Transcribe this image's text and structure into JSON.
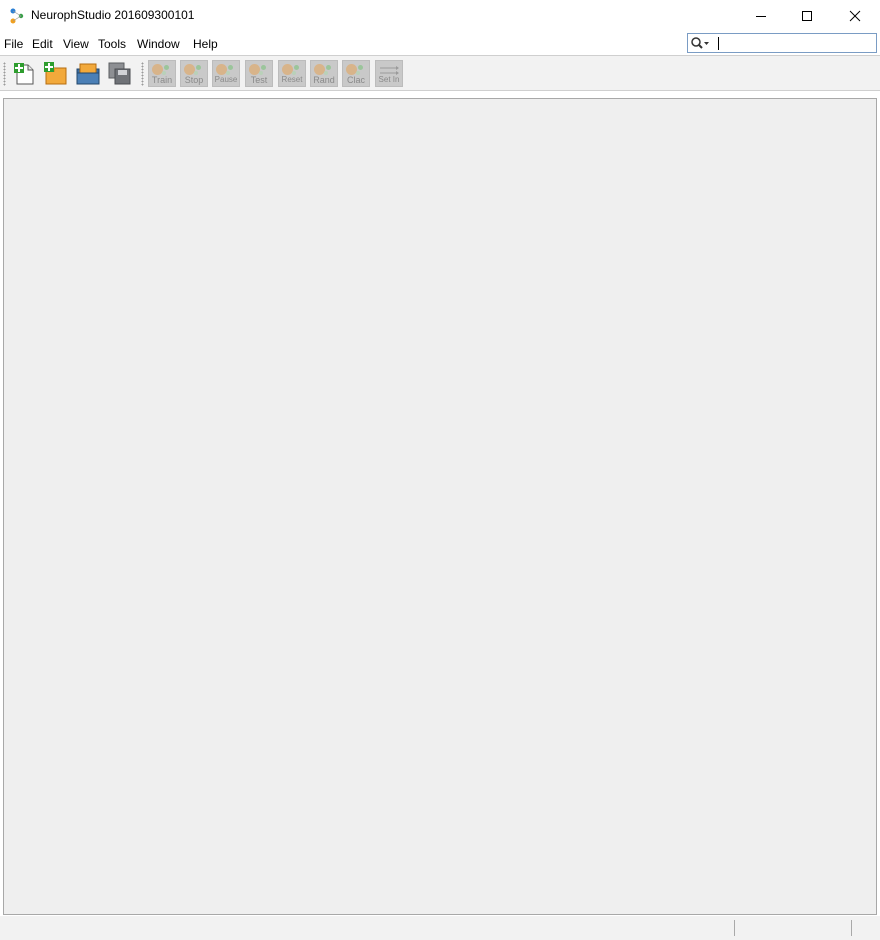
{
  "window": {
    "title": "NeurophStudio 201609300101",
    "controls": [
      "minimize-icon",
      "maximize-icon",
      "close-icon"
    ]
  },
  "menu": {
    "items": [
      {
        "label": "File"
      },
      {
        "label": "Edit"
      },
      {
        "label": "View"
      },
      {
        "label": "Tools"
      },
      {
        "label": "Window"
      },
      {
        "label": "Help"
      }
    ]
  },
  "search": {
    "value": "",
    "icon": "search-icon"
  },
  "toolbar": {
    "file_buttons": [
      {
        "icon": "new-file-icon"
      },
      {
        "icon": "new-project-icon"
      },
      {
        "icon": "open-project-icon"
      },
      {
        "icon": "save-all-icon"
      }
    ],
    "run_buttons": [
      {
        "label": "Train"
      },
      {
        "label": "Stop"
      },
      {
        "label": "Pause"
      },
      {
        "label": "Test"
      },
      {
        "label": "Reset"
      },
      {
        "label": "Rand"
      },
      {
        "label": "Clac"
      },
      {
        "label": "Set In"
      }
    ]
  },
  "colors": {
    "workspace": "#efefef",
    "toolbar": "#f2f2f2",
    "disabled_button": "#c9c9c9"
  }
}
